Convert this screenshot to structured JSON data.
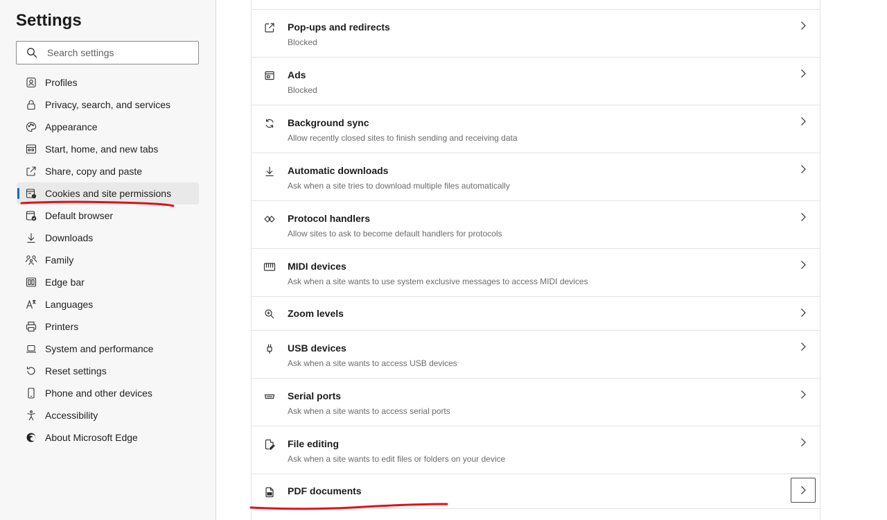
{
  "sidebar": {
    "title": "Settings",
    "search_placeholder": "Search settings",
    "items": [
      {
        "label": "Profiles",
        "icon": "profile-icon"
      },
      {
        "label": "Privacy, search, and services",
        "icon": "lock-icon"
      },
      {
        "label": "Appearance",
        "icon": "palette-icon"
      },
      {
        "label": "Start, home, and new tabs",
        "icon": "home-tabs-icon"
      },
      {
        "label": "Share, copy and paste",
        "icon": "share-icon"
      },
      {
        "label": "Cookies and site permissions",
        "icon": "cookies-permissions-icon",
        "active": true
      },
      {
        "label": "Default browser",
        "icon": "default-browser-icon"
      },
      {
        "label": "Downloads",
        "icon": "download-icon"
      },
      {
        "label": "Family",
        "icon": "family-icon"
      },
      {
        "label": "Edge bar",
        "icon": "edge-bar-icon"
      },
      {
        "label": "Languages",
        "icon": "languages-icon"
      },
      {
        "label": "Printers",
        "icon": "printer-icon"
      },
      {
        "label": "System and performance",
        "icon": "laptop-icon"
      },
      {
        "label": "Reset settings",
        "icon": "reset-icon"
      },
      {
        "label": "Phone and other devices",
        "icon": "phone-icon"
      },
      {
        "label": "Accessibility",
        "icon": "accessibility-icon"
      },
      {
        "label": "About Microsoft Edge",
        "icon": "edge-logo-icon"
      }
    ]
  },
  "permissions": [
    {
      "title": "Pop-ups and redirects",
      "subtitle": "Blocked",
      "icon": "popup-icon"
    },
    {
      "title": "Ads",
      "subtitle": "Blocked",
      "icon": "ads-icon"
    },
    {
      "title": "Background sync",
      "subtitle": "Allow recently closed sites to finish sending and receiving data",
      "icon": "sync-icon"
    },
    {
      "title": "Automatic downloads",
      "subtitle": "Ask when a site tries to download multiple files automatically",
      "icon": "download-icon"
    },
    {
      "title": "Protocol handlers",
      "subtitle": "Allow sites to ask to become default handlers for protocols",
      "icon": "protocol-icon"
    },
    {
      "title": "MIDI devices",
      "subtitle": "Ask when a site wants to use system exclusive messages to access MIDI devices",
      "icon": "midi-icon"
    },
    {
      "title": "Zoom levels",
      "subtitle": "",
      "icon": "zoom-icon"
    },
    {
      "title": "USB devices",
      "subtitle": "Ask when a site wants to access USB devices",
      "icon": "usb-icon"
    },
    {
      "title": "Serial ports",
      "subtitle": "Ask when a site wants to access serial ports",
      "icon": "serial-port-icon"
    },
    {
      "title": "File editing",
      "subtitle": "Ask when a site wants to edit files or folders on your device",
      "icon": "file-edit-icon"
    },
    {
      "title": "PDF documents",
      "subtitle": "",
      "icon": "pdf-icon"
    }
  ],
  "colors": {
    "accent": "#0f6cbd",
    "annotation": "#e0101a",
    "sidebar_bg": "#f7f7f7",
    "active_bg": "#e9e9e9"
  }
}
